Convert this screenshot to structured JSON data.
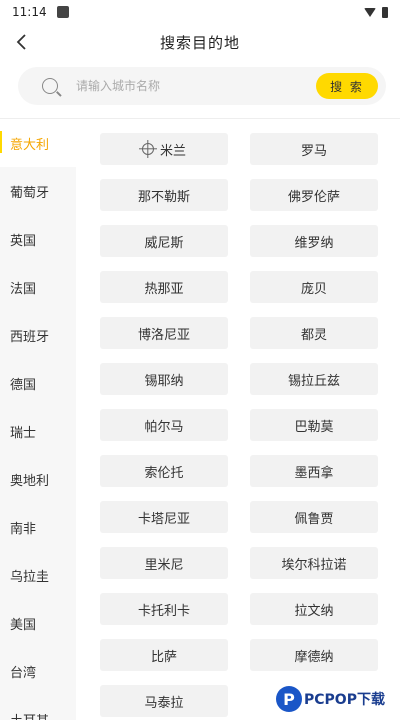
{
  "status": {
    "time": "11:14"
  },
  "header": {
    "title": "搜索目的地"
  },
  "search": {
    "placeholder": "请输入城市名称",
    "value": "",
    "button_label": "搜 索"
  },
  "countries": [
    {
      "label": "意大利",
      "active": true
    },
    {
      "label": "葡萄牙"
    },
    {
      "label": "英国"
    },
    {
      "label": "法国"
    },
    {
      "label": "西班牙"
    },
    {
      "label": "德国"
    },
    {
      "label": "瑞士"
    },
    {
      "label": "奥地利"
    },
    {
      "label": "南非"
    },
    {
      "label": "乌拉圭"
    },
    {
      "label": "美国"
    },
    {
      "label": "台湾"
    },
    {
      "label": "土耳其"
    }
  ],
  "cities": [
    {
      "label": "米兰",
      "icon": "locate-icon"
    },
    {
      "label": "罗马"
    },
    {
      "label": "那不勒斯"
    },
    {
      "label": "佛罗伦萨"
    },
    {
      "label": "威尼斯"
    },
    {
      "label": "维罗纳"
    },
    {
      "label": "热那亚"
    },
    {
      "label": "庞贝"
    },
    {
      "label": "博洛尼亚"
    },
    {
      "label": "都灵"
    },
    {
      "label": "锡耶纳"
    },
    {
      "label": "锡拉丘兹"
    },
    {
      "label": "帕尔马"
    },
    {
      "label": "巴勒莫"
    },
    {
      "label": "索伦托"
    },
    {
      "label": "墨西拿"
    },
    {
      "label": "卡塔尼亚"
    },
    {
      "label": "佩鲁贾"
    },
    {
      "label": "里米尼"
    },
    {
      "label": "埃尔科拉诺"
    },
    {
      "label": "卡托利卡"
    },
    {
      "label": "拉文纳"
    },
    {
      "label": "比萨"
    },
    {
      "label": "摩德纳"
    },
    {
      "label": "马泰拉"
    }
  ],
  "watermark": {
    "logo_letter": "P",
    "text": "PCPOP下载"
  },
  "colors": {
    "accent": "#ffd900",
    "active_text": "#f5a600",
    "sidebar_bg": "#f7f7f7",
    "chip_bg": "#f2f2f2"
  }
}
